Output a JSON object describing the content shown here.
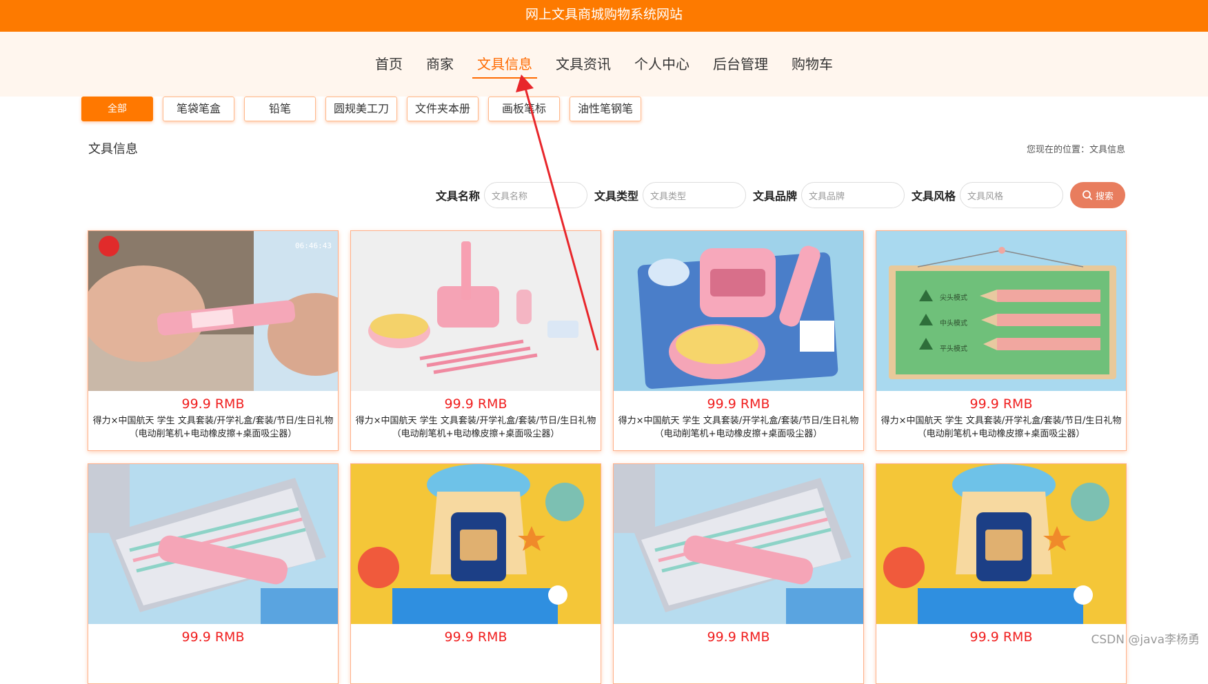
{
  "site_title": "网上文具商城购物系统网站",
  "nav": [
    "首页",
    "商家",
    "文具信息",
    "文具资讯",
    "个人中心",
    "后台管理",
    "购物车"
  ],
  "nav_active": "文具信息",
  "categories": [
    "全部",
    "笔袋笔盒",
    "铅笔",
    "圆规美工刀",
    "文件夹本册",
    "画板笔标",
    "油性笔钢笔"
  ],
  "page_title": "文具信息",
  "breadcrumb": "您现在的位置：文具信息",
  "search": {
    "name_label": "文具名称",
    "name_placeholder": "文具名称",
    "type_label": "文具类型",
    "type_placeholder": "文具类型",
    "brand_label": "文具品牌",
    "brand_placeholder": "文具品牌",
    "style_label": "文具风格",
    "style_placeholder": "文具风格",
    "button": "搜索"
  },
  "products": [
    {
      "price": "99.9 RMB",
      "desc": "得力×中国航天 学生 文具套装/开学礼盒/套装/节日/生日礼物（电动削笔机+电动橡皮擦+桌面吸尘器）",
      "img": "hand-eraser"
    },
    {
      "price": "99.9 RMB",
      "desc": "得力×中国航天 学生 文具套装/开学礼盒/套装/节日/生日礼物（电动削笔机+电动橡皮擦+桌面吸尘器）",
      "img": "pink-set-white"
    },
    {
      "price": "99.9 RMB",
      "desc": "得力×中国航天 学生 文具套装/开学礼盒/套装/节日/生日礼物（电动削笔机+电动橡皮擦+桌面吸尘器）",
      "img": "pink-set-blue"
    },
    {
      "price": "99.9 RMB",
      "desc": "得力×中国航天 学生 文具套装/开学礼盒/套装/节日/生日礼物（电动削笔机+电动橡皮擦+桌面吸尘器）",
      "img": "pencil-modes"
    },
    {
      "price": "99.9 RMB",
      "desc": "",
      "img": "pencil-case"
    },
    {
      "price": "99.9 RMB",
      "desc": "",
      "img": "space-sharpener"
    },
    {
      "price": "99.9 RMB",
      "desc": "",
      "img": "pencil-case"
    },
    {
      "price": "99.9 RMB",
      "desc": "",
      "img": "space-sharpener"
    }
  ],
  "pencil_modes": [
    "尖头模式",
    "中头模式",
    "平头模式"
  ],
  "watermark": "CSDN @java李杨勇",
  "colors": {
    "header": "#fd7a00",
    "accent": "#ff6a00",
    "price": "#f01f1f",
    "search_button": "#e87d5e"
  }
}
